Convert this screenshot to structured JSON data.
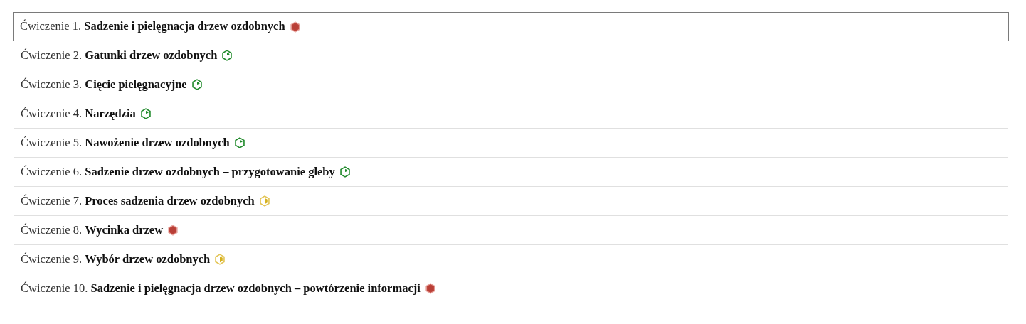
{
  "exercises": [
    {
      "prefix": "Ćwiczenie 1.",
      "title": "Sadzenie i pielęgnacja drzew ozdobnych",
      "kind": "filled",
      "selected": true
    },
    {
      "prefix": "Ćwiczenie 2.",
      "title": "Gatunki drzew ozdobnych",
      "kind": "slice",
      "selected": false
    },
    {
      "prefix": "Ćwiczenie 3.",
      "title": "Cięcie pielęgnacyjne",
      "kind": "slice",
      "selected": false
    },
    {
      "prefix": "Ćwiczenie 4.",
      "title": "Narzędzia",
      "kind": "slice",
      "selected": false
    },
    {
      "prefix": "Ćwiczenie 5.",
      "title": "Nawożenie drzew ozdobnych",
      "kind": "slice",
      "selected": false
    },
    {
      "prefix": "Ćwiczenie 6.",
      "title": "Sadzenie drzew ozdobnych – przygotowanie gleby",
      "kind": "slice",
      "selected": false
    },
    {
      "prefix": "Ćwiczenie 7.",
      "title": "Proces sadzenia drzew ozdobnych",
      "kind": "half",
      "selected": false
    },
    {
      "prefix": "Ćwiczenie 8.",
      "title": "Wycinka drzew",
      "kind": "filled",
      "selected": false
    },
    {
      "prefix": "Ćwiczenie 9.",
      "title": "Wybór drzew ozdobnych",
      "kind": "half",
      "selected": false
    },
    {
      "prefix": "Ćwiczenie 10.",
      "title": "Sadzenie i pielęgnacja drzew ozdobnych – powtórzenie informacji",
      "kind": "filled",
      "selected": false
    }
  ]
}
